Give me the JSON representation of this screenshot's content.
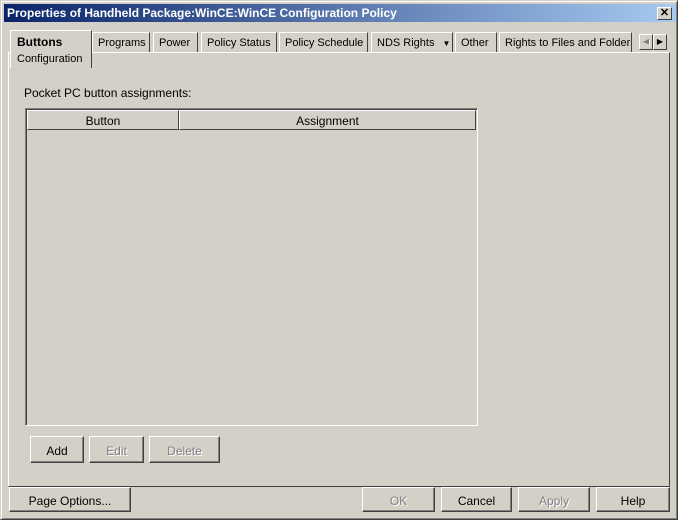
{
  "window": {
    "title": "Properties of Handheld Package:WinCE:WinCE Configuration Policy",
    "close": "✕"
  },
  "tabs": {
    "selected": {
      "label": "Buttons",
      "sublabel": "Configuration"
    },
    "items": [
      "Programs",
      "Power",
      "Policy Status",
      "Policy Schedule",
      "NDS Rights",
      "Other",
      "Rights to Files and Folders"
    ],
    "dropdown": "▼",
    "scroll_left": "◀",
    "scroll_right": "▶"
  },
  "panel": {
    "label": "Pocket PC button assignments:",
    "columns": [
      "Button",
      "Assignment"
    ],
    "buttons": {
      "add": "Add",
      "edit": "Edit",
      "delete": "Delete"
    }
  },
  "footer": {
    "page_options": "Page Options...",
    "ok": "OK",
    "cancel": "Cancel",
    "apply": "Apply",
    "help": "Help"
  }
}
